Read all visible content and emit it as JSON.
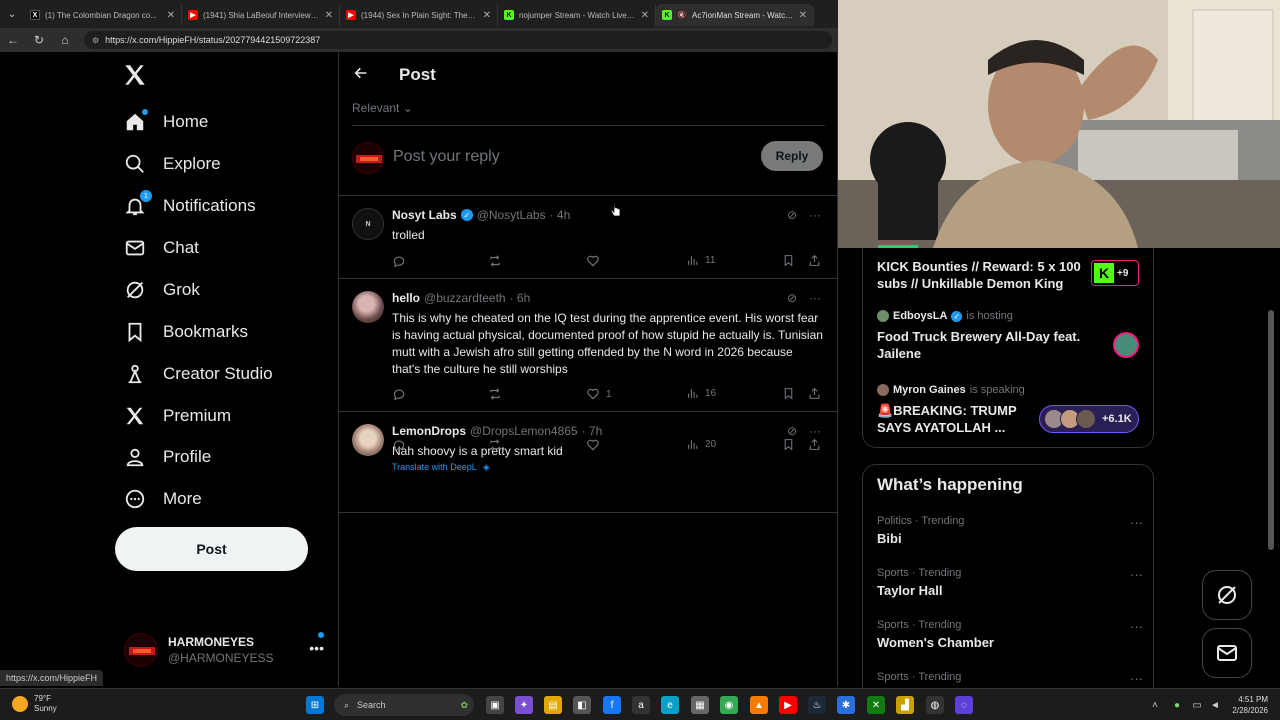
{
  "browser": {
    "tabs": [
      {
        "title": "(1) The Colombian Dragon co...",
        "active": false,
        "icon": "x-icon"
      },
      {
        "title": "(1941) Shia LaBeouf Interview - Yo",
        "active": false,
        "icon": "youtube-icon"
      },
      {
        "title": "(1944) Sex In Plain Sight: The Figu",
        "active": false,
        "icon": "youtube-icon"
      },
      {
        "title": "nojumper Stream - Watch Live on",
        "active": false,
        "icon": "kick-icon"
      },
      {
        "title": "Ac7ionMan Stream - Watch Li",
        "active": true,
        "icon": "kick-icon"
      }
    ],
    "url": "https://x.com/HippieFH/status/2027794421509722387",
    "status_url": "https://x.com/HippieFH"
  },
  "nav": {
    "items": [
      {
        "label": "Home",
        "icon": "home-icon"
      },
      {
        "label": "Explore",
        "icon": "search-icon"
      },
      {
        "label": "Notifications",
        "icon": "bell-icon",
        "badge": "1"
      },
      {
        "label": "Chat",
        "icon": "mail-icon"
      },
      {
        "label": "Grok",
        "icon": "grok-icon"
      },
      {
        "label": "Bookmarks",
        "icon": "bookmark-icon"
      },
      {
        "label": "Creator Studio",
        "icon": "creator-studio-icon"
      },
      {
        "label": "Premium",
        "icon": "x-premium-icon"
      },
      {
        "label": "Profile",
        "icon": "person-icon"
      },
      {
        "label": "More",
        "icon": "more-circle-icon"
      }
    ],
    "post_label": "Post",
    "account": {
      "name": "HARMONEYES",
      "handle": "@HARMONEYESS"
    }
  },
  "main": {
    "title": "Post",
    "sort_label": "Relevant",
    "composer_placeholder": "Post your reply",
    "reply_label": "Reply",
    "replies": [
      {
        "name": "Nosyt Labs",
        "verified": true,
        "handle": "@NosytLabs",
        "time": "· 4h",
        "text": "trolled",
        "likes": "",
        "views": "11",
        "translate": ""
      },
      {
        "name": "hello",
        "verified": false,
        "handle": "@buzzardteeth",
        "time": "· 6h",
        "text": "This is why he cheated on the IQ test during the apprentice event. His worst fear is having actual physical, documented proof of how stupid he actually is. Tunisian mutt with a Jewish afro still getting offended by the N word in 2026 because that's the culture he still worships",
        "likes": "1",
        "views": "16",
        "translate": ""
      },
      {
        "name": "LemonDrops",
        "verified": false,
        "handle": "@DropsLemon4865",
        "time": "· 7h",
        "text": "Nah shoovy is a pretty smart kid",
        "likes": "",
        "views": "20",
        "translate": "Translate with DeepL"
      }
    ]
  },
  "sidebar": {
    "spaces": [
      {
        "host": "",
        "host_status": "",
        "title": "KICK Bounties // Reward: 5 x 100 subs // Unkillable Demon King",
        "extra": "+9"
      },
      {
        "host": "EdboysLA",
        "host_status": "is hosting",
        "title": "Food Truck Brewery All-Day feat. Jailene",
        "extra": ""
      },
      {
        "host": "Myron Gaines",
        "host_status": "is speaking",
        "title": "🚨BREAKING: TRUMP SAYS AYATOLLAH ...",
        "extra": "+6.1K"
      }
    ],
    "happening_title": "What’s happening",
    "trends": [
      {
        "context": "Politics · Trending",
        "name": "Bibi"
      },
      {
        "context": "Sports · Trending",
        "name": "Taylor Hall"
      },
      {
        "context": "Sports · Trending",
        "name": "Women's Chamber"
      },
      {
        "context": "Sports · Trending",
        "name": ""
      }
    ]
  },
  "taskbar": {
    "temp": "79°F",
    "condition": "Sunny",
    "search_label": "Search",
    "time": "4:51 PM",
    "date": "2/28/2026"
  },
  "colors": {
    "accent": "#1d9bf0",
    "kick": "#53fc18",
    "space_border": "#f91880",
    "live_purple": "#7856ff"
  }
}
